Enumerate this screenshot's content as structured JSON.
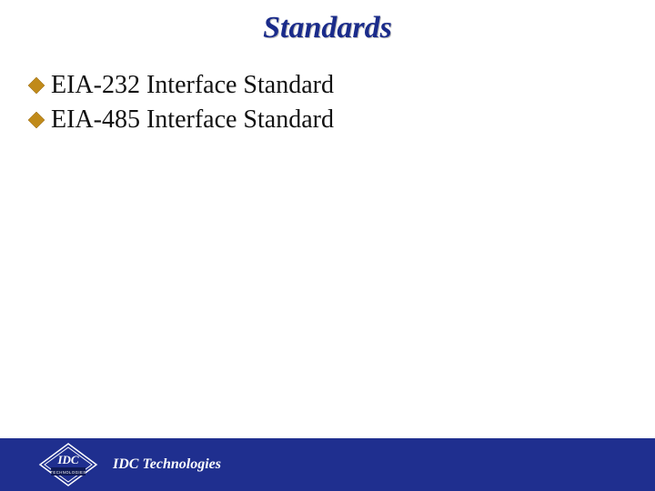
{
  "slide": {
    "title": "Standards",
    "bullets": [
      {
        "text": "EIA-232 Interface Standard"
      },
      {
        "text": "EIA-485 Interface Standard"
      }
    ]
  },
  "footer": {
    "company": "IDC Technologies",
    "logo_text_top": "IDC",
    "logo_text_bottom": "TECHNOLOGIES"
  },
  "colors": {
    "title": "#1a2b8a",
    "footer_bg": "#1f2f8f",
    "bullet_fill": "#c08a1a"
  }
}
